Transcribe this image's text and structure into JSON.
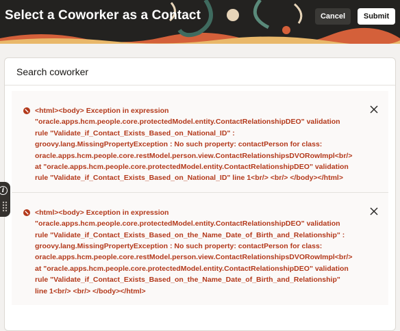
{
  "header": {
    "title": "Select a Coworker as a Contact",
    "cancel_label": "Cancel",
    "submit_label": "Submit"
  },
  "card": {
    "title": "Search coworker"
  },
  "messages": [
    {
      "severity": "error",
      "icon": "error-icon",
      "text": "<html><body> Exception in expression \"oracle.apps.hcm.people.core.protectedModel.entity.ContactRelationshipDEO\" validation rule \"Validate_if_Contact_Exists_Based_on_National_ID\" : groovy.lang.MissingPropertyException : No such property: contactPerson for class: oracle.apps.hcm.people.core.restModel.person.view.ContactRelationshipsDVORowImpl<br/> at \"oracle.apps.hcm.people.core.protectedModel.entity.ContactRelationshipDEO\" validation rule \"Validate_if_Contact_Exists_Based_on_National_ID\" line 1<br/> <br/> </body></html>"
    },
    {
      "severity": "error",
      "icon": "error-icon",
      "text": "<html><body> Exception in expression \"oracle.apps.hcm.people.core.protectedModel.entity.ContactRelationshipDEO\" validation rule \"Validate_if_Contact_Exists_Based_on_the_Name_Date_of_Birth_and_Relationship\" : groovy.lang.MissingPropertyException : No such property: contactPerson for class: oracle.apps.hcm.people.core.restModel.person.view.ContactRelationshipsDVORowImpl<br/> at \"oracle.apps.hcm.people.core.protectedModel.entity.ContactRelationshipDEO\" validation rule \"Validate_if_Contact_Exists_Based_on_the_Name_Date_of_Birth_and_Relationship\" line 1<br/> <br/> </body></html>"
    }
  ],
  "side_tab": {
    "info_glyph": "i"
  },
  "colors": {
    "header_bg": "#232220",
    "error_text": "#b3391b",
    "accent_orange": "#d4603a"
  }
}
